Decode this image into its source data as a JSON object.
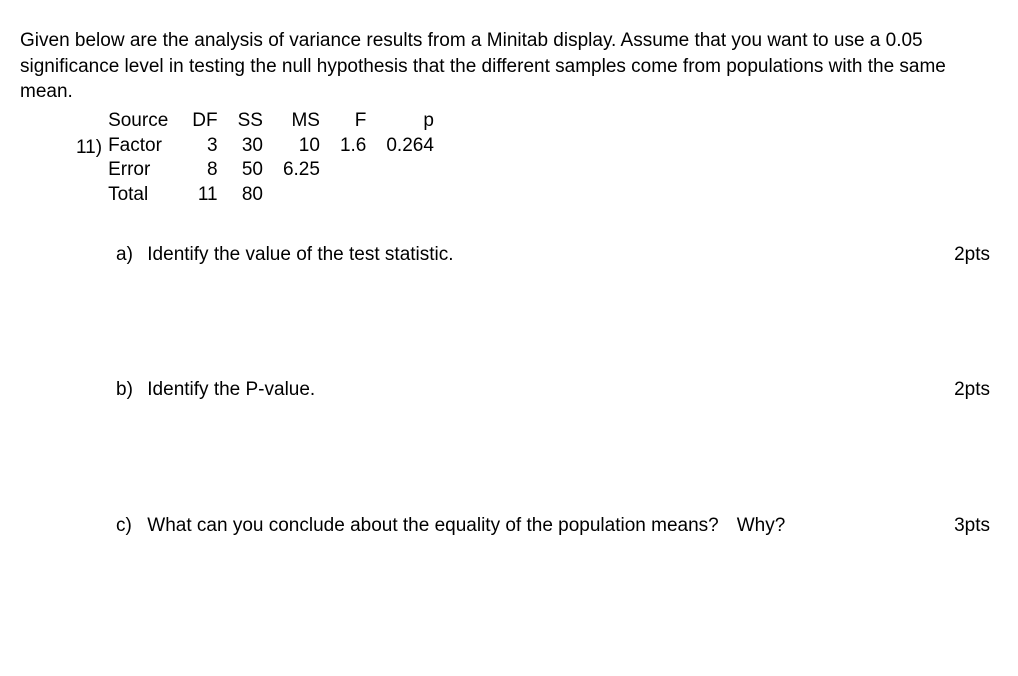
{
  "intro": "Given below are the analysis of variance results from a Minitab display.  Assume that you want to use a 0.05 significance level in testing the null hypothesis that the different samples come from populations with the same mean.",
  "question_number": "11)",
  "chart_data": {
    "type": "table",
    "headers": [
      "Source",
      "DF",
      "SS",
      "MS",
      "F",
      "p"
    ],
    "rows": [
      {
        "Source": "Factor",
        "DF": "3",
        "SS": "30",
        "MS": "10",
        "F": "1.6",
        "p": "0.264"
      },
      {
        "Source": "Error",
        "DF": "8",
        "SS": "50",
        "MS": "6.25",
        "F": "",
        "p": ""
      },
      {
        "Source": "Total",
        "DF": "11",
        "SS": "80",
        "MS": "",
        "F": "",
        "p": ""
      }
    ]
  },
  "parts": {
    "a": {
      "label": "a)",
      "text": "Identify the value of the test statistic.",
      "pts": "2pts"
    },
    "b": {
      "label": "b)",
      "text": "Identify the P-value.",
      "pts": "2pts"
    },
    "c": {
      "label": "c)",
      "text": "What can you conclude about the equality of the population means?",
      "why": "Why?",
      "pts": "3pts"
    }
  }
}
